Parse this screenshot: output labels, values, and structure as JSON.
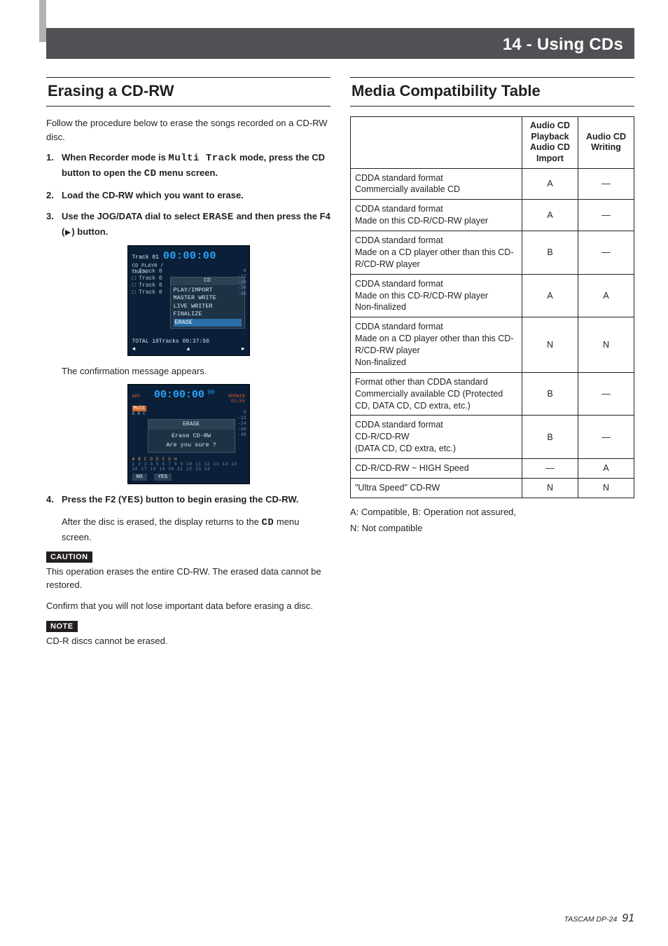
{
  "header": {
    "chapter_title": "14 - Using CDs"
  },
  "left": {
    "section_title": "Erasing a CD-RW",
    "intro": "Follow the procedure below to erase the songs recorded on a CD-RW disc.",
    "steps": [
      {
        "pre": "When Recorder mode is ",
        "mono": "Multi Track",
        "mid": " mode, press the CD button to open the ",
        "mono2": "CD",
        "post": " menu screen."
      },
      {
        "text": "Load the CD-RW which you want to erase."
      },
      {
        "pre": "Use the JOG/DATA dial to select ",
        "mono": "ERASE",
        "mid": " and then press the F4 (",
        "post": ") button."
      },
      {
        "pre": "Press the F2 (",
        "mono": "YES",
        "post": ") button to begin erasing the CD-RW."
      }
    ],
    "confirm_msg": "The confirmation message appears.",
    "after_erase_pre": "After the disc is erased, the display returns to the ",
    "after_erase_mono": "CD",
    "after_erase_post": " menu screen.",
    "caution_label": "CAUTION",
    "caution_p1": "This operation erases the entire CD-RW. The erased data cannot be restored.",
    "caution_p2": "Confirm that you will not lose important data before erasing a disc.",
    "note_label": "NOTE",
    "note_p1": "CD-R discs cannot be erased.",
    "shot1": {
      "track_label": "Track 01",
      "timecode": "00:00:00",
      "panel": "CD PLAYR /",
      "track_sub": "TRACK",
      "menu_title": "CD",
      "menu_items": [
        "PLAY/IMPORT",
        "MASTER WRITE",
        "LIVE WRITER",
        "FINALIZE",
        "ERASE"
      ],
      "list_rows": [
        "□ Track 0",
        "□ Track 0",
        "□ Track 0",
        "□ Track 0"
      ],
      "total": "TOTAL  10Tracks 00:37:50",
      "bottom": {
        "left": "◄",
        "mid": "▲",
        "right": "►"
      },
      "meter": [
        "0",
        "-12",
        "-24",
        "-36",
        "-48"
      ]
    },
    "shot2": {
      "abs": "ABS",
      "timecode": "00:00:00",
      "tc_small": "00",
      "remain_label": "REMAIN",
      "remain_val": "03:59",
      "mode_badge": "Mult",
      "abc": "A B C",
      "dialog_title": "ERASE",
      "dialog_line1": "Erase CD-RW",
      "dialog_line2": "Are you sure ?",
      "tracknums_hot": "A B C D E F G H",
      "tracknums": "1 2 3 4 5 6 7 8 9 10 11 12 13 14 15 16 17 18 19 20 21 22 23 24",
      "btn_no": "NO",
      "btn_yes": "YES",
      "meter": [
        "0",
        "-12",
        "-24",
        "-36",
        "-48"
      ]
    }
  },
  "right": {
    "section_title": "Media Compatibility Table",
    "thead": {
      "col1": "",
      "col2": "Audio CD Playback Audio CD Import",
      "col3": "Audio CD Writing"
    },
    "rows": [
      {
        "desc": "CDDA standard format\nCommercially available CD",
        "pb": "A",
        "wr": "—"
      },
      {
        "desc": "CDDA standard format\nMade on this CD-R/CD-RW player",
        "pb": "A",
        "wr": "—"
      },
      {
        "desc": "CDDA standard format\nMade on a CD player other than this CD-R/CD-RW player",
        "pb": "B",
        "wr": "—"
      },
      {
        "desc": "CDDA standard format\nMade on this CD-R/CD-RW player\nNon-finalized",
        "pb": "A",
        "wr": "A"
      },
      {
        "desc": "CDDA standard format\nMade on a CD player other than this CD-R/CD-RW player\nNon-finalized",
        "pb": "N",
        "wr": "N"
      },
      {
        "desc": "Format other than CDDA standard\nCommercially available CD (Protected CD, DATA CD, CD extra, etc.)",
        "pb": "B",
        "wr": "—"
      },
      {
        "desc": "CDDA standard format\nCD-R/CD-RW\n(DATA CD, CD extra, etc.)",
        "pb": "B",
        "wr": "—"
      },
      {
        "desc": "CD-R/CD-RW ~ HIGH Speed",
        "pb": "—",
        "wr": "A"
      },
      {
        "desc": "\"Ultra Speed\" CD-RW",
        "pb": "N",
        "wr": "N"
      }
    ],
    "legend1": "A: Compatible, B: Operation not assured,",
    "legend2": "N: Not compatible"
  },
  "footer": {
    "brand_model": "TASCAM DP-24",
    "page": "91"
  }
}
